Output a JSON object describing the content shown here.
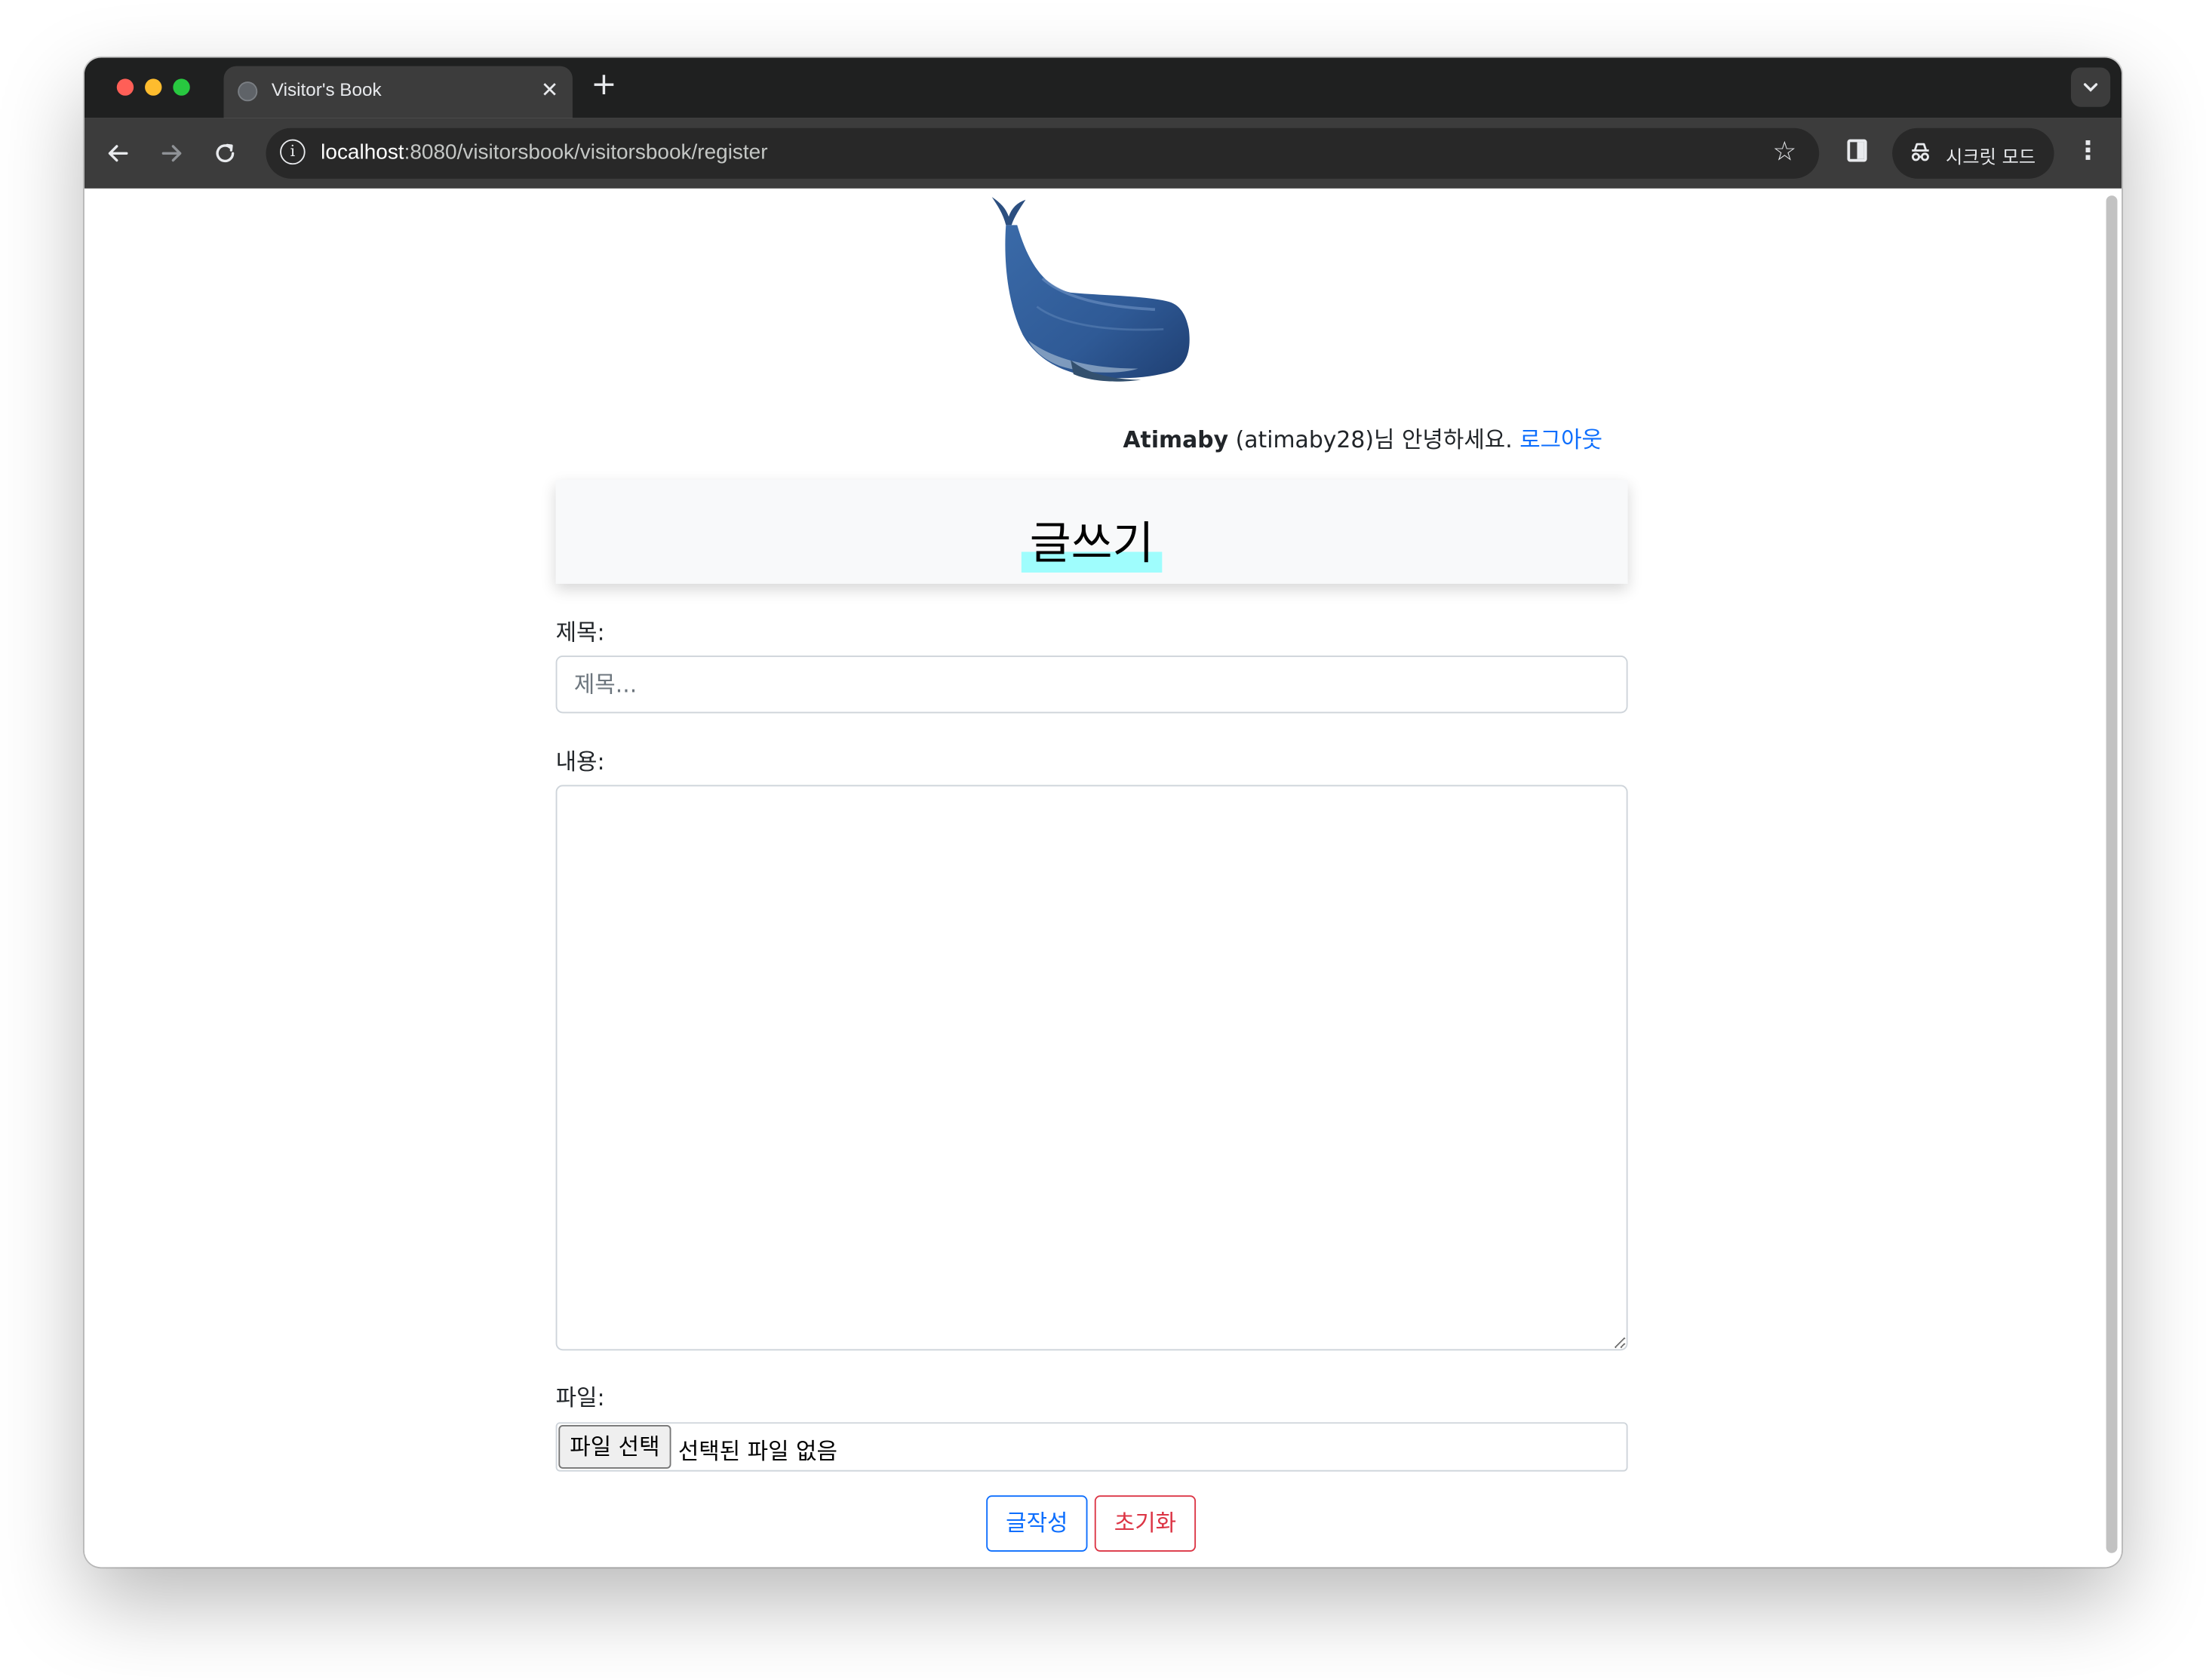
{
  "browser": {
    "tab_title": "Visitor's Book",
    "tab_close": "✕",
    "new_tab": "+",
    "tab_menu": "⌄",
    "url_host": "localhost",
    "url_rest": ":8080/visitorsbook/visitorsbook/register",
    "incognito_label": "시크릿 모드",
    "icons": {
      "back": "arrow-left-icon",
      "forward": "arrow-right-icon",
      "reload": "reload-icon",
      "site_info": "info-icon",
      "bookmark": "star-icon",
      "side_panel": "side-panel-icon",
      "incognito": "incognito-icon",
      "menu": "kebab-menu-icon"
    }
  },
  "page": {
    "greeting": {
      "user_name": "Atimaby",
      "user_id": " (atimaby28)님 안녕하세요. ",
      "logout_label": "로그아웃"
    },
    "heading": "글쓰기",
    "form": {
      "title_label": "제목:",
      "title_placeholder": "제목...",
      "title_value": "",
      "content_label": "내용:",
      "file_label": "파일:",
      "file_button": "파일 선택",
      "file_status": "선택된 파일 없음",
      "submit_label": "글작성",
      "reset_label": "초기화"
    },
    "colors": {
      "primary": "#0d6efd",
      "danger": "#dc3545",
      "heading_highlight": "#9ffdfd"
    }
  }
}
